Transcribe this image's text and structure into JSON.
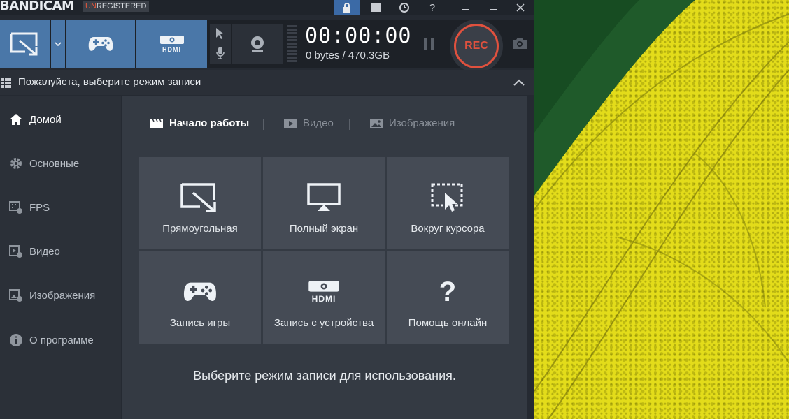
{
  "titlebar": {
    "logo": "BANDICAM",
    "registration_prefix": "UN",
    "registration_suffix": "REGISTERED"
  },
  "toolbar": {
    "timer": "00:00:00",
    "storage": "0 bytes / 470.3GB",
    "rec_label": "REC",
    "hdmi_label": "HDMI"
  },
  "modebar": {
    "title": "Пожалуйста, выберите режим записи"
  },
  "sidebar": {
    "items": [
      {
        "label": "Домой",
        "icon": "home-icon"
      },
      {
        "label": "Основные",
        "icon": "gear-icon"
      },
      {
        "label": "FPS",
        "icon": "fps-icon"
      },
      {
        "label": "Видео",
        "icon": "video-settings-icon"
      },
      {
        "label": "Изображения",
        "icon": "image-settings-icon"
      },
      {
        "label": "О программе",
        "icon": "info-icon"
      }
    ]
  },
  "tabs": [
    {
      "label": "Начало работы"
    },
    {
      "label": "Видео"
    },
    {
      "label": "Изображения"
    }
  ],
  "tiles": [
    {
      "label": "Прямоугольная",
      "icon": "rectangle-area-icon"
    },
    {
      "label": "Полный экран",
      "icon": "monitor-icon"
    },
    {
      "label": "Вокруг курсора",
      "icon": "cursor-area-icon"
    },
    {
      "label": "Запись игры",
      "icon": "gamepad-icon"
    },
    {
      "label": "Запись с устройства",
      "icon": "hdmi-icon"
    },
    {
      "label": "Помощь онлайн",
      "icon": "help-icon"
    }
  ],
  "hint": "Выберите режим записи для использования.",
  "colors": {
    "accent": "#4a77a8",
    "rec": "#e0513e",
    "background_field": "#e3dc1a"
  }
}
